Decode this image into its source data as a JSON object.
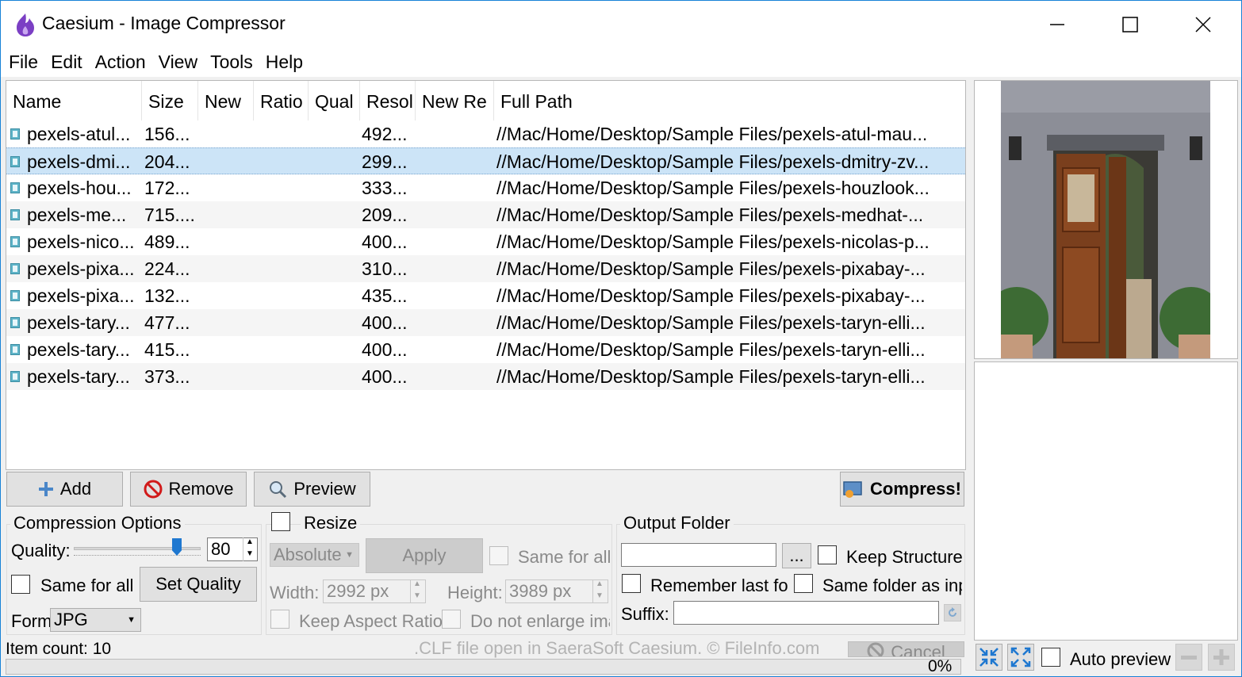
{
  "window": {
    "title": "Caesium - Image Compressor",
    "icon": "caesium-app-icon",
    "controls": [
      "minimize-icon",
      "maximize-icon",
      "close-icon"
    ]
  },
  "menu": [
    "File",
    "Edit",
    "Action",
    "View",
    "Tools",
    "Help"
  ],
  "table": {
    "columns": [
      "Name",
      "Size",
      "New",
      "Ratio",
      "Qual",
      "Resol",
      "New Re",
      "Full Path"
    ],
    "rows": [
      {
        "name": "pexels-atul...",
        "size": "156...",
        "resolution": "492...",
        "path": "//Mac/Home/Desktop/Sample Files/pexels-atul-mau..."
      },
      {
        "name": "pexels-dmi...",
        "size": "204...",
        "resolution": "299...",
        "path": "//Mac/Home/Desktop/Sample Files/pexels-dmitry-zv..."
      },
      {
        "name": "pexels-hou...",
        "size": "172...",
        "resolution": "333...",
        "path": "//Mac/Home/Desktop/Sample Files/pexels-houzlook..."
      },
      {
        "name": "pexels-me...",
        "size": "715....",
        "resolution": "209...",
        "path": "//Mac/Home/Desktop/Sample Files/pexels-medhat-..."
      },
      {
        "name": "pexels-nico...",
        "size": "489...",
        "resolution": "400...",
        "path": "//Mac/Home/Desktop/Sample Files/pexels-nicolas-p..."
      },
      {
        "name": "pexels-pixa...",
        "size": "224...",
        "resolution": "310...",
        "path": "//Mac/Home/Desktop/Sample Files/pexels-pixabay-..."
      },
      {
        "name": "pexels-pixa...",
        "size": "132...",
        "resolution": "435...",
        "path": "//Mac/Home/Desktop/Sample Files/pexels-pixabay-..."
      },
      {
        "name": "pexels-tary...",
        "size": "477...",
        "resolution": "400...",
        "path": "//Mac/Home/Desktop/Sample Files/pexels-taryn-elli..."
      },
      {
        "name": "pexels-tary...",
        "size": "415...",
        "resolution": "400...",
        "path": "//Mac/Home/Desktop/Sample Files/pexels-taryn-elli..."
      },
      {
        "name": "pexels-tary...",
        "size": "373...",
        "resolution": "400...",
        "path": "//Mac/Home/Desktop/Sample Files/pexels-taryn-elli..."
      }
    ],
    "selected_row": 1
  },
  "toolbar": {
    "add": "Add",
    "remove": "Remove",
    "preview": "Preview",
    "compress": "Compress!"
  },
  "compression": {
    "title": "Compression Options",
    "quality_label": "Quality:",
    "quality_value": "80",
    "quality_level": 0.8,
    "same_for_all": "Same for all",
    "set_quality": "Set Quality",
    "format_label": "Form",
    "format_value": "JPG"
  },
  "resize": {
    "title": "Resize",
    "mode": "Absolute",
    "apply": "Apply",
    "same_for_all": "Same for all",
    "width_label": "Width:",
    "width_value": "2992 px",
    "height_label": "Height:",
    "height_value": "3989 px",
    "keep_aspect": "Keep Aspect Ratio",
    "no_enlarge": "Do not enlarge ima"
  },
  "output": {
    "title": "Output Folder",
    "folder_value": "",
    "browse": "...",
    "keep_structure": "Keep Structure",
    "remember_last": "Remember last fol",
    "same_folder": "Same folder as inp",
    "suffix_label": "Suffix:",
    "suffix_value": ""
  },
  "status": {
    "item_count": "Item count: 10",
    "watermark": ".CLF file open in SaeraSoft Caesium. © FileInfo.com",
    "cancel": "Cancel",
    "progress": "0%",
    "progress_value": 0,
    "auto_preview": "Auto preview"
  },
  "colors": {
    "selection": "#cce4f7",
    "accent": "#1f78d0",
    "window_border": "#1883d7"
  }
}
